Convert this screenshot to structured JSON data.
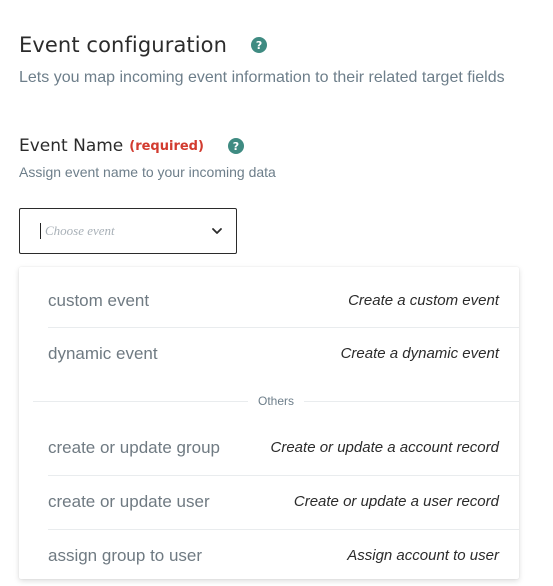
{
  "section": {
    "title": "Event configuration",
    "help_glyph": "?",
    "subtitle": "Lets you map incoming event information to their related target fields"
  },
  "field": {
    "label": "Event Name",
    "required_tag": "(required)",
    "help_glyph": "?",
    "help_text": "Assign event name to your incoming data",
    "placeholder": "Choose event",
    "value": ""
  },
  "dropdown": {
    "options_top": [
      {
        "label": "custom event",
        "description": "Create a custom event"
      },
      {
        "label": "dynamic event",
        "description": "Create a dynamic event"
      }
    ],
    "group_label": "Others",
    "options_others": [
      {
        "label": "create or update group",
        "description": "Create or update a account record"
      },
      {
        "label": "create or update user",
        "description": "Create or update a user record"
      },
      {
        "label": "assign group to user",
        "description": "Assign account to user"
      }
    ]
  },
  "colors": {
    "help_icon": "#3f8b82",
    "required": "#d23b2f",
    "muted_text": "#6d7e8a"
  },
  "icons": {
    "help": "question-circle-icon",
    "dropdown": "chevron-down-icon"
  }
}
